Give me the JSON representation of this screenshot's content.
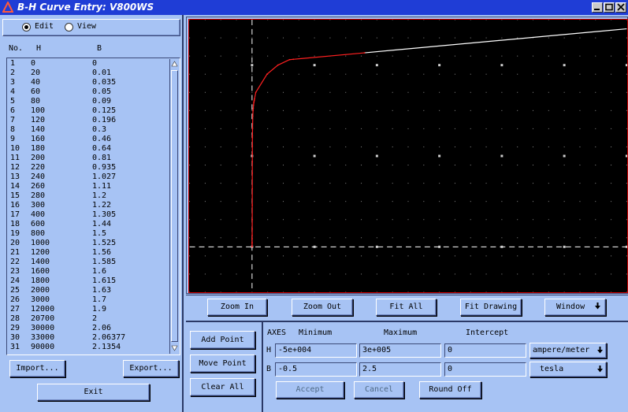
{
  "window": {
    "title": "B-H Curve Entry: V800WS"
  },
  "mode": {
    "edit_label": "Edit",
    "view_label": "View",
    "selected": "Edit"
  },
  "table": {
    "headers": {
      "no": "No.",
      "h": "H",
      "b": "B"
    },
    "rows": [
      [
        "1",
        "0",
        "0"
      ],
      [
        "2",
        "20",
        "0.01"
      ],
      [
        "3",
        "40",
        "0.035"
      ],
      [
        "4",
        "60",
        "0.05"
      ],
      [
        "5",
        "80",
        "0.09"
      ],
      [
        "6",
        "100",
        "0.125"
      ],
      [
        "7",
        "120",
        "0.196"
      ],
      [
        "8",
        "140",
        "0.3"
      ],
      [
        "9",
        "160",
        "0.46"
      ],
      [
        "10",
        "180",
        "0.64"
      ],
      [
        "11",
        "200",
        "0.81"
      ],
      [
        "12",
        "220",
        "0.935"
      ],
      [
        "13",
        "240",
        "1.027"
      ],
      [
        "14",
        "260",
        "1.11"
      ],
      [
        "15",
        "280",
        "1.2"
      ],
      [
        "16",
        "300",
        "1.22"
      ],
      [
        "17",
        "400",
        "1.305"
      ],
      [
        "18",
        "600",
        "1.44"
      ],
      [
        "19",
        "800",
        "1.5"
      ],
      [
        "20",
        "1000",
        "1.525"
      ],
      [
        "21",
        "1200",
        "1.56"
      ],
      [
        "22",
        "1400",
        "1.585"
      ],
      [
        "23",
        "1600",
        "1.6"
      ],
      [
        "24",
        "1800",
        "1.615"
      ],
      [
        "25",
        "2000",
        "1.63"
      ],
      [
        "26",
        "3000",
        "1.7"
      ],
      [
        "27",
        "12000",
        "1.9"
      ],
      [
        "28",
        "20700",
        "2"
      ],
      [
        "29",
        "30000",
        "2.06"
      ],
      [
        "30",
        "33000",
        "2.06377"
      ],
      [
        "31",
        "90000",
        "2.1354"
      ]
    ]
  },
  "buttons": {
    "import": "Import...",
    "export": "Export...",
    "exit": "Exit",
    "zoom_in": "Zoom In",
    "zoom_out": "Zoom Out",
    "fit_all": "Fit All",
    "fit_drawing": "Fit Drawing",
    "window": "Window",
    "add_point": "Add Point",
    "move_point": "Move Point",
    "clear_all": "Clear All",
    "accept": "Accept",
    "cancel": "Cancel",
    "round_off": "Round Off"
  },
  "axes": {
    "header": {
      "axes": "AXES",
      "minimum": "Minimum",
      "maximum": "Maximum",
      "intercept": "Intercept"
    },
    "h": {
      "label": "H",
      "min": "-5e+004",
      "max": "3e+005",
      "intercept": "0",
      "unit": "ampere/meter"
    },
    "b": {
      "label": "B",
      "min": "-0.5",
      "max": "2.5",
      "intercept": "0",
      "unit": "tesla"
    }
  },
  "chart_data": {
    "type": "line",
    "xlim": [
      -50000,
      300000
    ],
    "ylim": [
      -0.5,
      2.5
    ],
    "grid": true,
    "colors": {
      "before_last": "#ff2020",
      "after_last": "#ffffff",
      "background": "#000000"
    },
    "x": [
      0,
      20,
      40,
      60,
      80,
      100,
      120,
      140,
      160,
      180,
      200,
      220,
      240,
      260,
      280,
      300,
      400,
      600,
      800,
      1000,
      1200,
      1400,
      1600,
      1800,
      2000,
      3000,
      12000,
      20700,
      30000,
      33000,
      90000,
      300000
    ],
    "y": [
      0,
      0.01,
      0.035,
      0.05,
      0.09,
      0.125,
      0.196,
      0.3,
      0.46,
      0.64,
      0.81,
      0.935,
      1.027,
      1.11,
      1.2,
      1.22,
      1.305,
      1.44,
      1.5,
      1.525,
      1.56,
      1.585,
      1.6,
      1.615,
      1.63,
      1.7,
      1.9,
      2,
      2.06,
      2.06377,
      2.1354,
      2.4
    ]
  },
  "icons": {
    "logo": "red-triangle-logo",
    "window": "dropdown-arrow-icon"
  }
}
